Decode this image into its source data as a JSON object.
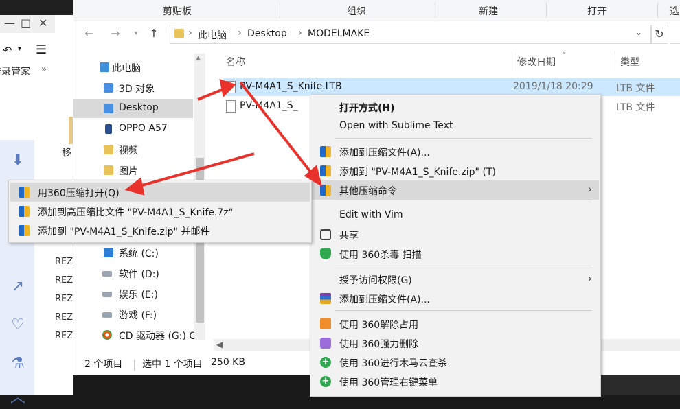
{
  "ribbon": {
    "groups": [
      "剪贴板",
      "组织",
      "新建",
      "打开",
      "选"
    ]
  },
  "address": {
    "crumbs": [
      "此电脑",
      "Desktop",
      "MODELMAKE"
    ]
  },
  "background_app": {
    "subtitle": "登录管家",
    "sidebar_text": "移",
    "list_fragments": [
      "REZ",
      "REZ",
      "REZ",
      "REZ",
      "REZ"
    ]
  },
  "navpane": {
    "items": [
      {
        "label": "此电脑",
        "icon": "pc-icon"
      },
      {
        "label": "3D 对象",
        "icon": "3d-objects-icon"
      },
      {
        "label": "Desktop",
        "icon": "desktop-icon"
      },
      {
        "label": "OPPO A57",
        "icon": "phone-icon"
      },
      {
        "label": "视频",
        "icon": "video-folder-icon"
      },
      {
        "label": "图片",
        "icon": "picture-folder-icon"
      },
      {
        "label": "系统 (C:)",
        "icon": "windows-drive-icon"
      },
      {
        "label": "软件 (D:)",
        "icon": "drive-icon"
      },
      {
        "label": "娱乐 (E:)",
        "icon": "drive-icon"
      },
      {
        "label": "游戏 (F:)",
        "icon": "drive-icon"
      },
      {
        "label": "CD 驱动器 (G:) C",
        "icon": "cd-drive-icon"
      }
    ]
  },
  "filelist": {
    "columns": {
      "name": "名称",
      "date": "修改日期",
      "type": "类型"
    },
    "rows": [
      {
        "name": "PV-M4A1_S_Knife.LTB",
        "date": "2019/1/18 20:29",
        "type": "LTB 文件",
        "selected": true
      },
      {
        "name": "PV-M4A1_S_",
        "date": "",
        "type": "LTB 文件",
        "selected": false
      }
    ]
  },
  "status": {
    "count": "2 个项目",
    "selection": "选中 1 个项目",
    "size": "250 KB"
  },
  "context_menu": {
    "items": [
      {
        "label": "打开方式(H)",
        "bold": true,
        "icon": ""
      },
      {
        "label": "Open with Sublime Text",
        "icon": ""
      },
      {
        "label": "添加到压缩文件(A)...",
        "icon": "360zip-icon"
      },
      {
        "label": "添加到 \"PV-M4A1_S_Knife.zip\" (T)",
        "icon": "360zip-icon"
      },
      {
        "label": "其他压缩命令",
        "icon": "360zip-icon",
        "submenu": true,
        "hover": true
      },
      {
        "label": "Edit with Vim",
        "icon": ""
      },
      {
        "label": "共享",
        "icon": "share-icon"
      },
      {
        "label": "使用 360杀毒 扫描",
        "icon": "360-antivirus-icon"
      },
      {
        "label": "授予访问权限(G)",
        "icon": "",
        "submenu": true
      },
      {
        "label": "添加到压缩文件(A)...",
        "icon": "winrar-icon"
      },
      {
        "label": "使用 360解除占用",
        "icon": "360-unlock-icon"
      },
      {
        "label": "使用 360强力删除",
        "icon": "360-force-delete-icon"
      },
      {
        "label": "使用 360进行木马云查杀",
        "icon": "360-cloud-scan-icon"
      },
      {
        "label": "使用 360管理右键菜单",
        "icon": "360-menu-manager-icon"
      }
    ]
  },
  "submenu": {
    "items": [
      {
        "label": "用360压缩打开(Q)",
        "hover": true
      },
      {
        "label": "添加到高压缩比文件 \"PV-M4A1_S_Knife.7z\""
      },
      {
        "label": "添加到 \"PV-M4A1_S_Knife.zip\" 并邮件"
      }
    ]
  },
  "colors": {
    "selection": "#cce8ff",
    "hover": "#dadada",
    "arrow": "#e8312a"
  }
}
